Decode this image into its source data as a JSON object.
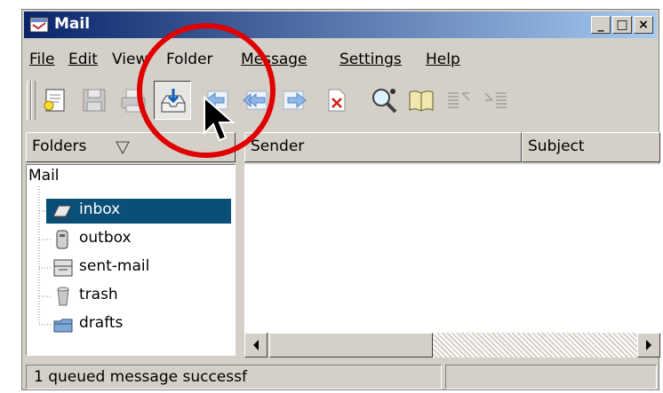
{
  "window": {
    "title": "Mail"
  },
  "menu": {
    "items": [
      {
        "label": "File"
      },
      {
        "label": "Edit"
      },
      {
        "label": "View"
      },
      {
        "label": "Folder"
      },
      {
        "label": "Message"
      },
      {
        "label": "Settings"
      },
      {
        "label": "Help"
      }
    ]
  },
  "toolbar": {
    "buttons": [
      {
        "icon": "new-message-icon"
      },
      {
        "icon": "save-icon"
      },
      {
        "icon": "print-icon"
      },
      {
        "icon": "check-mail-icon",
        "pressed": true
      },
      {
        "icon": "reply-icon"
      },
      {
        "icon": "reply-all-icon"
      },
      {
        "icon": "forward-icon"
      },
      {
        "icon": "delete-icon"
      },
      {
        "icon": "find-icon"
      },
      {
        "icon": "addressbook-icon"
      },
      {
        "icon": "previous-message-icon"
      },
      {
        "icon": "next-message-icon"
      }
    ]
  },
  "folders_header": "Folders",
  "columns": {
    "sender": "Sender",
    "subject": "Subject"
  },
  "tree": {
    "root": "Mail",
    "folders": [
      {
        "label": "inbox",
        "selected": true
      },
      {
        "label": "outbox"
      },
      {
        "label": "sent-mail"
      },
      {
        "label": "trash"
      },
      {
        "label": "drafts"
      }
    ]
  },
  "status": {
    "message": "1 queued message successf",
    "secondary": ""
  },
  "annotation": {
    "color": "#e00000"
  }
}
